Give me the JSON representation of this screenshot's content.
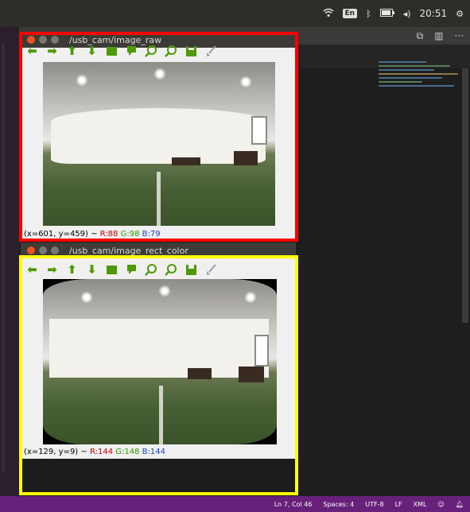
{
  "topbar": {
    "tray_icons": [
      "wifi-icon",
      "keyboard-layout-icon",
      "bluetooth-icon",
      "battery-icon",
      "volume-icon",
      "settings-gear-icon"
    ],
    "keyboard_layout": "En",
    "clock": "20:51"
  },
  "editor": {
    "titlebar_actions": [
      "split-editor-icon",
      "layout-icon",
      "more-icon"
    ],
    "status": {
      "position": "Ln 7, Col 46",
      "spaces": "Spaces: 4",
      "encoding": "UTF-8",
      "eol": "LF",
      "language": "XML"
    }
  },
  "viewer_top": {
    "title": "/usb_cam/image_raw",
    "coords_prefix": "(x=601, y=459) ~ ",
    "r": "R:88",
    "g": "G:98",
    "b": "B:79"
  },
  "viewer_bottom": {
    "title": "/usb_cam/image_rect_color",
    "coords_prefix": "(x=129, y=9) ~ ",
    "r": "R:144",
    "g": "G:148",
    "b": "B:144"
  },
  "toolbar_icons": [
    "back-icon",
    "forward-icon",
    "up-icon",
    "down-icon",
    "home-icon",
    "pan-icon",
    "zoom-in-icon",
    "zoom-out-icon",
    "save-icon",
    "clear-icon"
  ],
  "colors": {
    "highlight_top": "#ff0000",
    "highlight_bottom": "#ffff00",
    "statusbar": "#68217a",
    "toolbar_icon": "#4e9a06"
  }
}
